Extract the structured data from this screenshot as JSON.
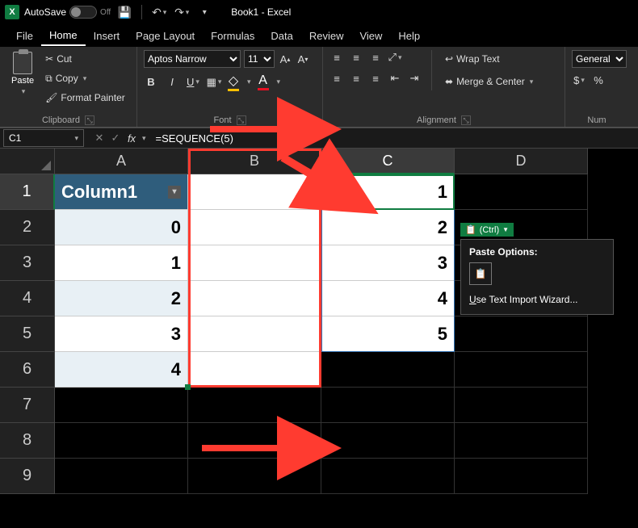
{
  "titlebar": {
    "autosave_label": "AutoSave",
    "autosave_state": "Off",
    "document_title": "Book1 - Excel"
  },
  "tabs": [
    "File",
    "Home",
    "Insert",
    "Page Layout",
    "Formulas",
    "Data",
    "Review",
    "View",
    "Help"
  ],
  "active_tab": "Home",
  "ribbon": {
    "clipboard": {
      "paste": "Paste",
      "cut": "Cut",
      "copy": "Copy",
      "format_painter": "Format Painter",
      "group_label": "Clipboard"
    },
    "font": {
      "font_name": "Aptos Narrow",
      "font_size": "11",
      "group_label": "Font"
    },
    "alignment": {
      "wrap_text": "Wrap Text",
      "merge_center": "Merge & Center",
      "group_label": "Alignment"
    },
    "number": {
      "format": "General",
      "group_label": "Num"
    }
  },
  "formula_bar": {
    "name_box": "C1",
    "formula": "=SEQUENCE(5)"
  },
  "columns": [
    "A",
    "B",
    "C",
    "D"
  ],
  "rows": [
    "1",
    "2",
    "3",
    "4",
    "5",
    "6",
    "7",
    "8",
    "9"
  ],
  "cells": {
    "A1": "Column1",
    "A2": "0",
    "A3": "1",
    "A4": "2",
    "A5": "3",
    "A6": "4",
    "C1": "1",
    "C2": "2",
    "C3": "3",
    "C4": "4",
    "C5": "5"
  },
  "paste_options": {
    "tag": "(Ctrl)",
    "header": "Paste Options:",
    "wizard": "Use Text Import Wizard..."
  },
  "chart_data": {
    "type": "table",
    "note": "Excel spreadsheet data as visible",
    "columns": [
      "A (Column1)",
      "C"
    ],
    "rows": [
      {
        "A": 0,
        "C": 1
      },
      {
        "A": 1,
        "C": 2
      },
      {
        "A": 2,
        "C": 3
      },
      {
        "A": 3,
        "C": 4
      },
      {
        "A": 4,
        "C": 5
      }
    ],
    "formula_C1": "=SEQUENCE(5)"
  }
}
